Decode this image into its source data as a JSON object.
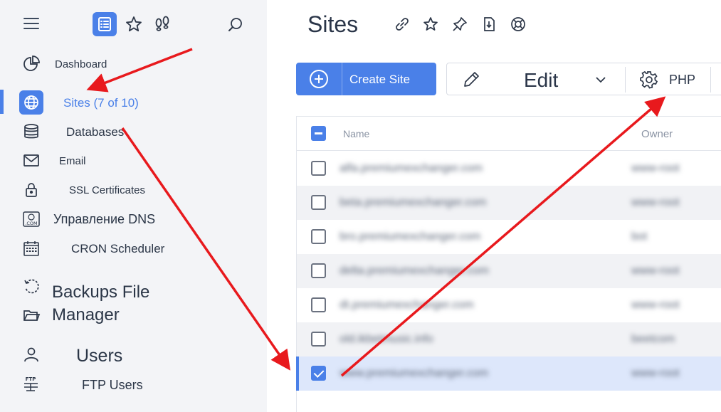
{
  "sidebar": {
    "items": [
      {
        "label": "Dashboard",
        "icon": "pie-chart-icon"
      },
      {
        "label": "Sites (7 of 10)",
        "icon": "globe-icon"
      },
      {
        "label": "Databases",
        "icon": "database-icon"
      },
      {
        "label": "Email",
        "icon": "envelope-icon"
      },
      {
        "label": "SSL Certificates",
        "icon": "lock-icon"
      },
      {
        "label": "Управление DNS",
        "icon": "dns-com-icon"
      },
      {
        "label": "CRON Scheduler",
        "icon": "calendar-icon"
      },
      {
        "label": "Backups File",
        "icon": "backup-icon"
      },
      {
        "label": "Manager",
        "icon": "folder-icon"
      },
      {
        "label": "Users",
        "icon": "user-icon"
      },
      {
        "label": "FTP Users",
        "icon": "ftp-icon"
      }
    ]
  },
  "main": {
    "title": "Sites",
    "toolbar": {
      "create_label": "Create Site",
      "edit_label": "Edit",
      "php_label": "PHP"
    },
    "table": {
      "columns": [
        "Name",
        "Owner"
      ],
      "rows": [
        {
          "name": "alfa.premiumexchanger.com",
          "owner": "www-root",
          "checked": false
        },
        {
          "name": "beta.premiumexchanger.com",
          "owner": "www-root",
          "checked": false
        },
        {
          "name": "bro.premiumexchanger.com",
          "owner": "bot",
          "checked": false
        },
        {
          "name": "delta.premiumexchanger.com",
          "owner": "www-root",
          "checked": false
        },
        {
          "name": "dt.premiumexchanger.com",
          "owner": "www-root",
          "checked": false
        },
        {
          "name": "old.ikbetmusic.info",
          "owner": "beetcom",
          "checked": false
        },
        {
          "name": "www.premiumexchanger.com",
          "owner": "www-root",
          "checked": true
        }
      ]
    }
  },
  "colors": {
    "accent": "#4a80e8",
    "arrow": "#e8191d",
    "sidebar_bg": "#f3f4f7"
  }
}
